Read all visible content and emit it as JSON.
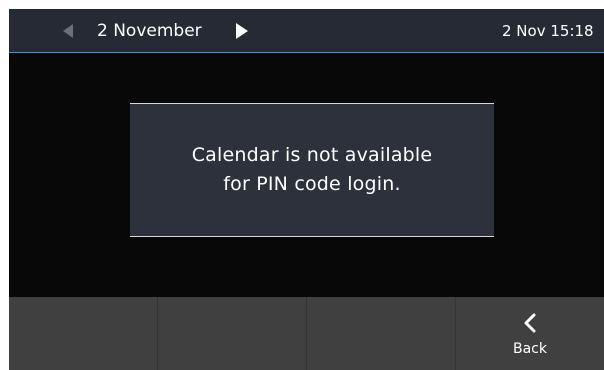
{
  "header": {
    "date_label": "2 November",
    "clock": "2 Nov 15:18",
    "prev_icon": "triangle-left-icon",
    "next_icon": "triangle-right-icon"
  },
  "dialog": {
    "message_line1": "Calendar is not available",
    "message_line2": "for PIN code login."
  },
  "softkeys": {
    "back_label": "Back",
    "back_icon": "chevron-left-icon"
  },
  "colors": {
    "header_bg": "#252a34",
    "header_accent": "#2f9ad6",
    "screen_bg": "#080808",
    "dialog_bg": "#2c313c",
    "softkey_bg": "#404040",
    "nav_prev_disabled": "#6a6f78"
  }
}
